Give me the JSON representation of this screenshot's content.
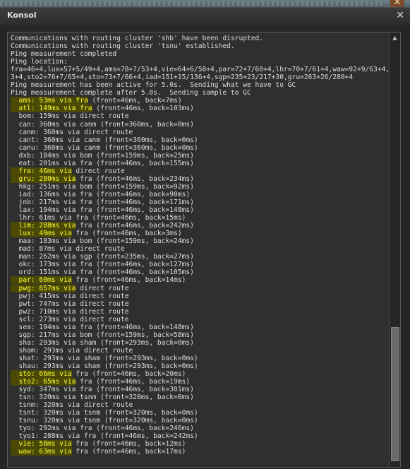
{
  "window": {
    "title": "Konsol",
    "close_glyph": "✕",
    "background_close_glyph": "✕",
    "scroll_up_glyph": "▲"
  },
  "colors": {
    "console_text": "#dcdcdc",
    "highlight_text": "#ffff32",
    "highlight_bg": "#4a4a06",
    "console_bg": "#2f2f2f"
  },
  "console": {
    "lines": [
      {
        "text": "Communications with routing cluster 'shb' have been disrupted."
      },
      {
        "text": "Communications with routing cluster 'tsnu' established."
      },
      {
        "text": "Ping measurement completed"
      },
      {
        "text": "Ping location:"
      },
      {
        "text": "fra=46+4,lux=57+5/49+4,ams=78+7/53+4,vie=64+6/58+4,par=72+7/60+4,lhr=70+7/61+4,waw=92+9/63+4,"
      },
      {
        "text": "3+4,sto2=76+7/65+4,sto=73+7/66+4,iad=151+15/136+4,sgp=235+23/217+30,gru=263+26/280+4"
      },
      {
        "text": "Ping measurement has been active for 5.0s.  Sending what we have to GC"
      },
      {
        "text": "Ping measurement complete after 5.0s.  Sending sample to GC"
      },
      {
        "hl": "  ams: 53ms via fra",
        "rest": " (front=46ms, back=7ms)"
      },
      {
        "hl": "  atl: 149ms via fra",
        "rest": " (front=46ms, back=103ms)"
      },
      {
        "text": "  bom: 159ms via direct route"
      },
      {
        "text": "  can: 360ms via canm (front=360ms, back=0ms)"
      },
      {
        "text": "  canm: 360ms via direct route"
      },
      {
        "text": "  cant: 360ms via canm (front=360ms, back=0ms)"
      },
      {
        "text": "  canu: 360ms via canm (front=360ms, back=0ms)"
      },
      {
        "text": "  dxb: 184ms via bom (front=159ms, back=25ms)"
      },
      {
        "text": "  eat: 201ms via fra (front=46ms, back=155ms)"
      },
      {
        "hl": "  fra: 46ms via",
        "rest": " direct route"
      },
      {
        "hl": "  gru: 280ms via",
        "rest": " fra (front=46ms, back=234ms)"
      },
      {
        "text": "  hkg: 251ms via bom (front=159ms, back=92ms)"
      },
      {
        "text": "  iad: 136ms via fra (front=46ms, back=90ms)"
      },
      {
        "text": "  jnb: 217ms via fra (front=46ms, back=171ms)"
      },
      {
        "text": "  lax: 194ms via fra (front=46ms, back=148ms)"
      },
      {
        "text": "  lhr: 61ms via fra (front=46ms, back=15ms)"
      },
      {
        "hl": "  lim: 288ms via",
        "rest": " fra (front=46ms, back=242ms)"
      },
      {
        "hl": "  lux: 49ms via",
        "rest": " fra (front=46ms, back=3ms)"
      },
      {
        "text": "  maa: 183ms via bom (front=159ms, back=24ms)"
      },
      {
        "text": "  mad: 87ms via direct route"
      },
      {
        "text": "  man: 262ms via sgp (front=235ms, back=27ms)"
      },
      {
        "text": "  okc: 173ms via fra (front=46ms, back=127ms)"
      },
      {
        "text": "  ord: 151ms via fra (front=46ms, back=105ms)"
      },
      {
        "hl": "  par: 60ms via",
        "rest": " fra (front=46ms, back=14ms)"
      },
      {
        "hl": "  pwg: 657ms via",
        "rest": " direct route"
      },
      {
        "text": "  pwj: 415ms via direct route"
      },
      {
        "text": "  pwt: 747ms via direct route"
      },
      {
        "text": "  pwz: 710ms via direct route"
      },
      {
        "text": "  scl: 273ms via direct route"
      },
      {
        "text": "  sea: 194ms via fra (front=46ms, back=148ms)"
      },
      {
        "text": "  sgp: 217ms via bom (front=159ms, back=58ms)"
      },
      {
        "text": "  sha: 293ms via sham (front=293ms, back=0ms)"
      },
      {
        "text": "  sham: 293ms via direct route"
      },
      {
        "text": "  shat: 293ms via sham (front=293ms, back=0ms)"
      },
      {
        "text": "  shau: 293ms via sham (front=293ms, back=0ms)"
      },
      {
        "hl": "  sto: 66ms via",
        "rest": " fra (front=46ms, back=20ms)"
      },
      {
        "hl": "  sto2: 65ms via",
        "rest": " fra (front=46ms, back=19ms)"
      },
      {
        "text": "  syd: 347ms via fra (front=46ms, back=301ms)"
      },
      {
        "text": "  tsn: 320ms via tsnm (front=320ms, back=0ms)"
      },
      {
        "text": "  tsnm: 320ms via direct route"
      },
      {
        "text": "  tsnt: 320ms via tsnm (front=320ms, back=0ms)"
      },
      {
        "text": "  tsnu: 320ms via tsnm (front=320ms, back=0ms)"
      },
      {
        "text": "  tyo: 292ms via fra (front=46ms, back=246ms)"
      },
      {
        "text": "  tyo1: 288ms via fra (front=46ms, back=242ms)"
      },
      {
        "hl": "  vie: 58ms via",
        "rest": " fra (front=46ms, back=12ms)"
      },
      {
        "hl": "  waw: 63ms via",
        "rest": " fra (front=46ms, back=17ms)"
      }
    ]
  }
}
